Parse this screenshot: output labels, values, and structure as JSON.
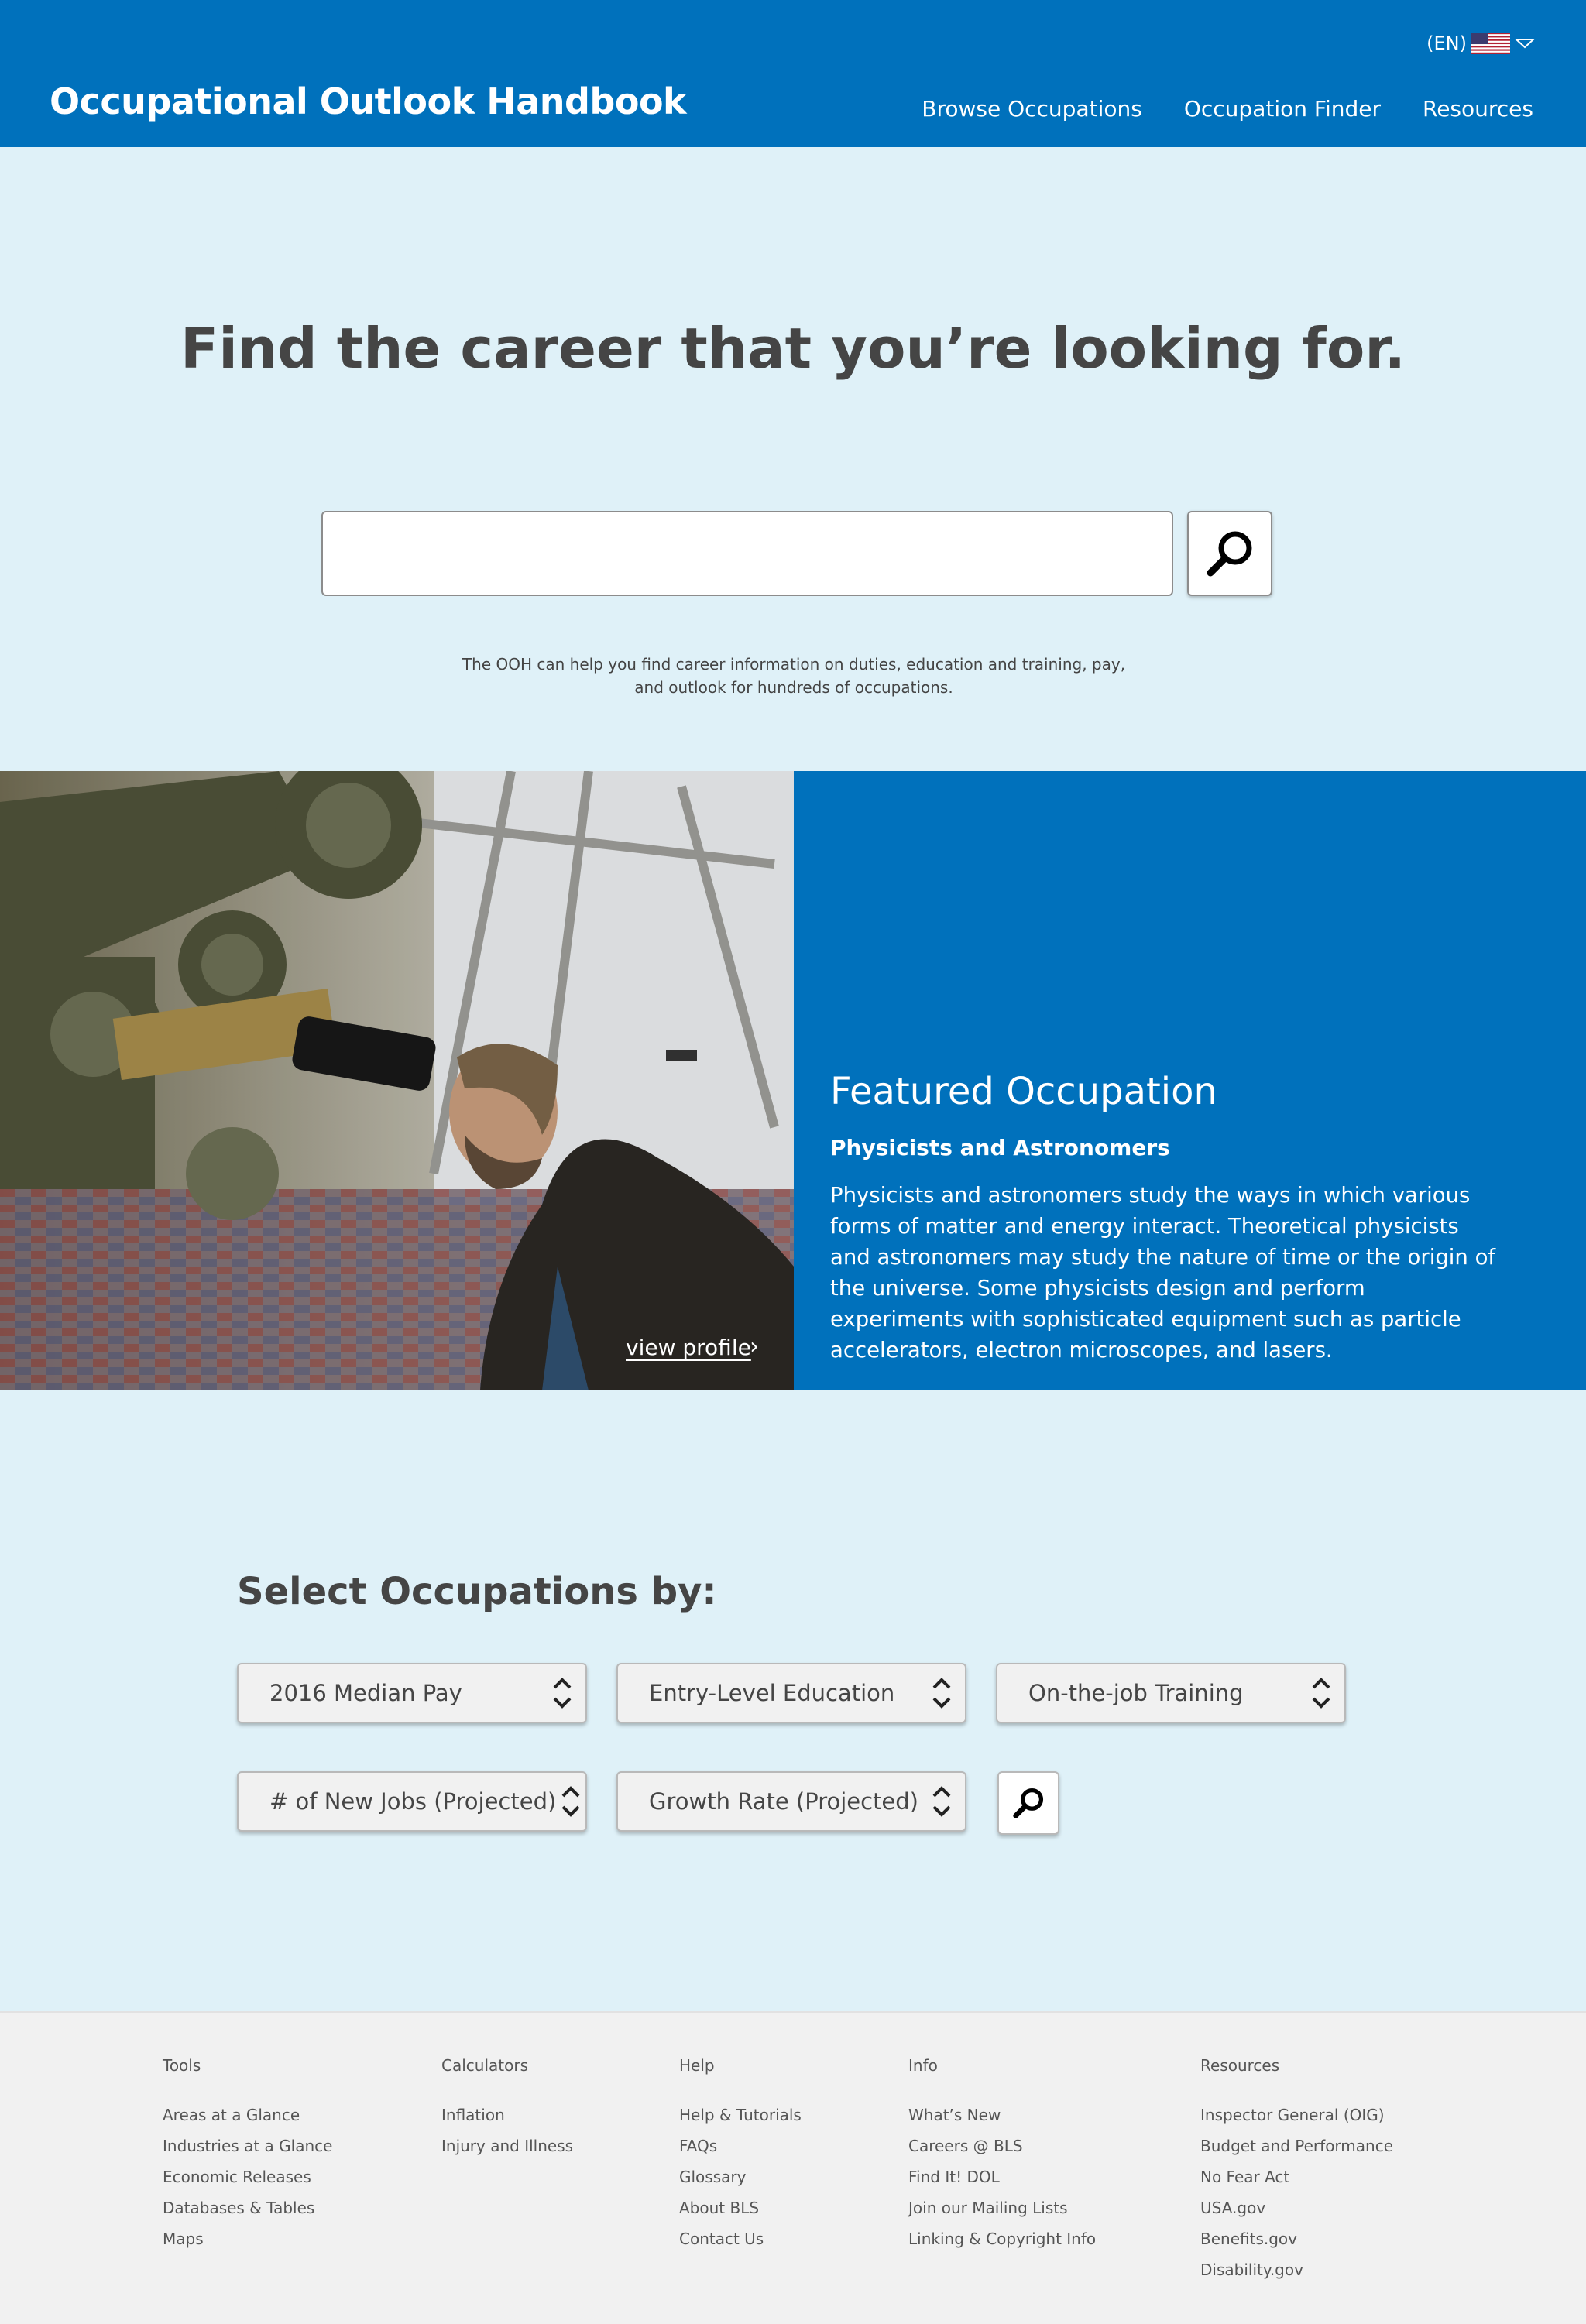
{
  "header": {
    "language": "(EN)",
    "brand": "Occupational Outlook Handbook",
    "nav": [
      "Browse Occupations",
      "Occupation Finder",
      "Resources"
    ]
  },
  "hero": {
    "title": "Find the career that you’re looking for.",
    "search_value": "",
    "description": "The OOH can help you find career information on duties, education and training, pay, and outlook for hundreds of occupations."
  },
  "featured": {
    "heading": "Featured Occupation",
    "name": "Physicists and Astronomers",
    "body": "Physicists and astronomers study the ways in which various forms of matter and energy interact. Theoretical physicists and astronomers may study the nature of time or the origin of the universe. Some physicists design and perform experiments with sophisticated equipment such as particle accelerators, electron microscopes, and lasers.",
    "view_profile": "view profile",
    "arrow": "›"
  },
  "select": {
    "heading": "Select Occupations by:",
    "dropdowns": [
      "2016 Median Pay",
      "Entry-Level Education",
      "On-the-job Training",
      "# of New Jobs (Projected)",
      "Growth Rate (Projected)"
    ]
  },
  "footer": {
    "columns": [
      {
        "title": "Tools",
        "links": [
          "Areas at a Glance",
          "Industries at a Glance",
          "Economic Releases",
          "Databases & Tables",
          "Maps"
        ]
      },
      {
        "title": "Calculators",
        "links": [
          "Inflation",
          "Injury and Illness"
        ]
      },
      {
        "title": "Help",
        "links": [
          "Help & Tutorials",
          "FAQs",
          "Glossary",
          "About BLS",
          "Contact Us"
        ]
      },
      {
        "title": "Info",
        "links": [
          "What’s New",
          "Careers @ BLS",
          "Find It! DOL",
          "Join our Mailing Lists",
          "Linking & Copyright Info"
        ]
      },
      {
        "title": "Resources",
        "links": [
          "Inspector General (OIG)",
          "Budget and Performance",
          "No Fear Act",
          "USA.gov",
          "Benefits.gov",
          "Disability.gov"
        ]
      }
    ]
  },
  "colors": {
    "header_blue": "#0071bc",
    "page_background": "#dff1f8",
    "footer_background": "#f1f1f1"
  },
  "icons": [
    "us-flag-icon",
    "caret-down-icon",
    "search-icon",
    "updown-arrows-icon",
    "chevron-right-icon"
  ]
}
